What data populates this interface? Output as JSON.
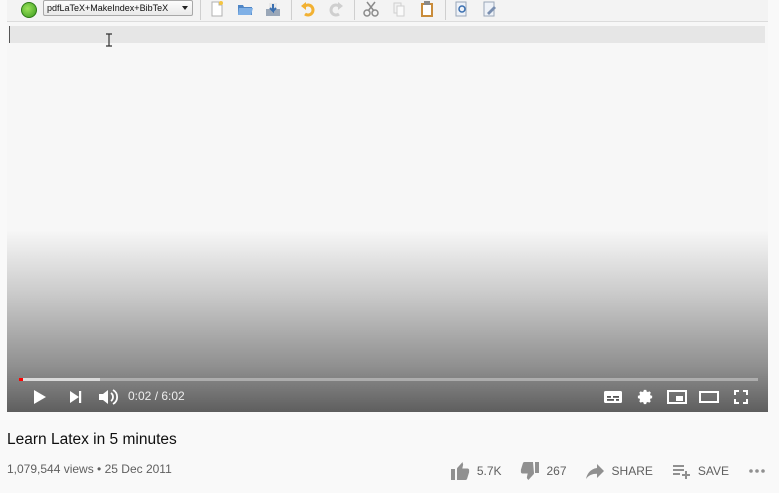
{
  "toolbar": {
    "compiler_option": "pdfLaTeX+MakeIndex+BibTeX",
    "icons": [
      "new-file-icon",
      "open-folder-icon",
      "save-icon",
      "undo-icon",
      "redo-icon",
      "cut-icon",
      "copy-icon",
      "paste-icon",
      "find-icon",
      "find-replace-icon"
    ]
  },
  "player": {
    "current_time": "0:02",
    "duration": "6:02",
    "time_display": "0:02 / 6:02",
    "progress_played": 0.0055,
    "progress_buffered": 0.11
  },
  "video": {
    "title": "Learn Latex in 5 minutes",
    "views": "1,079,544 views",
    "date": "25 Dec 2011",
    "meta_line": "1,079,544 views • 25 Dec 2011",
    "likes": "5.7K",
    "dislikes": "267",
    "share_label": "SHARE",
    "save_label": "SAVE"
  },
  "colors": {
    "progress_played": "#ff0000",
    "text_primary": "#0f0f0f",
    "text_secondary": "#606060"
  }
}
